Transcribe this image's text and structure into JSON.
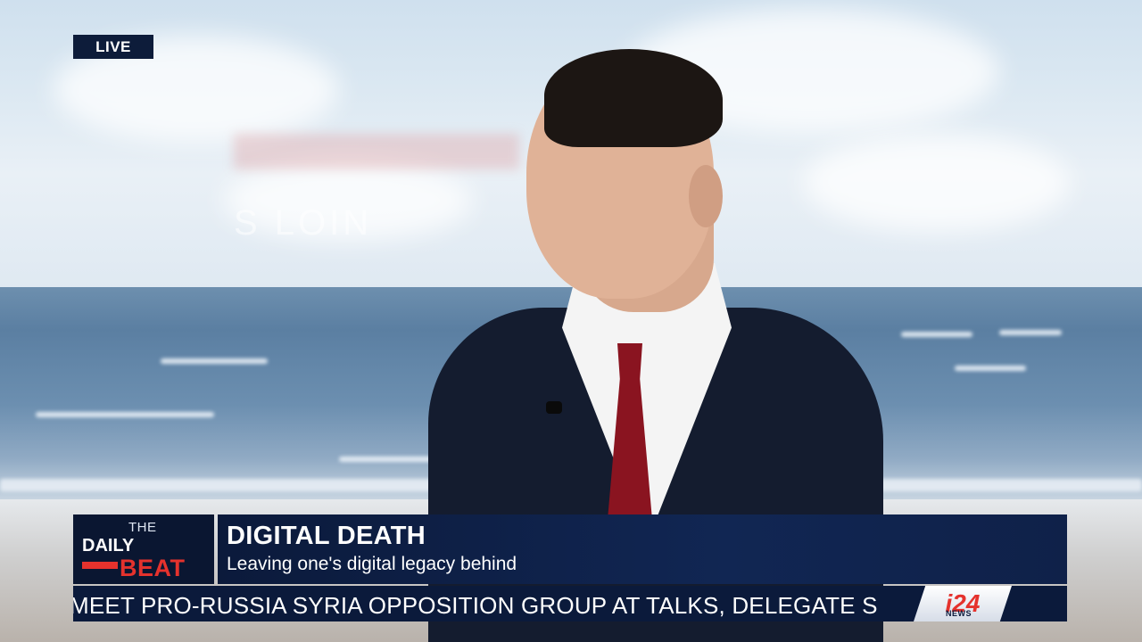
{
  "badge": {
    "live": "LIVE"
  },
  "show": {
    "the": "THE",
    "daily": "DAILY",
    "beat": "BEAT"
  },
  "headline": {
    "title": "DIGITAL DEATH",
    "subtitle": "Leaving one's digital legacy behind"
  },
  "ticker": {
    "text": "MEET PRO-RUSSIA SYRIA OPPOSITION GROUP AT TALKS, DELEGATE S",
    "logo": "i24",
    "logo_sub": "NEWS"
  },
  "background": {
    "sign_text": "S LOIN"
  },
  "colors": {
    "navy": "#0b1a3b",
    "accent_red": "#e5322d",
    "text": "#ffffff"
  }
}
